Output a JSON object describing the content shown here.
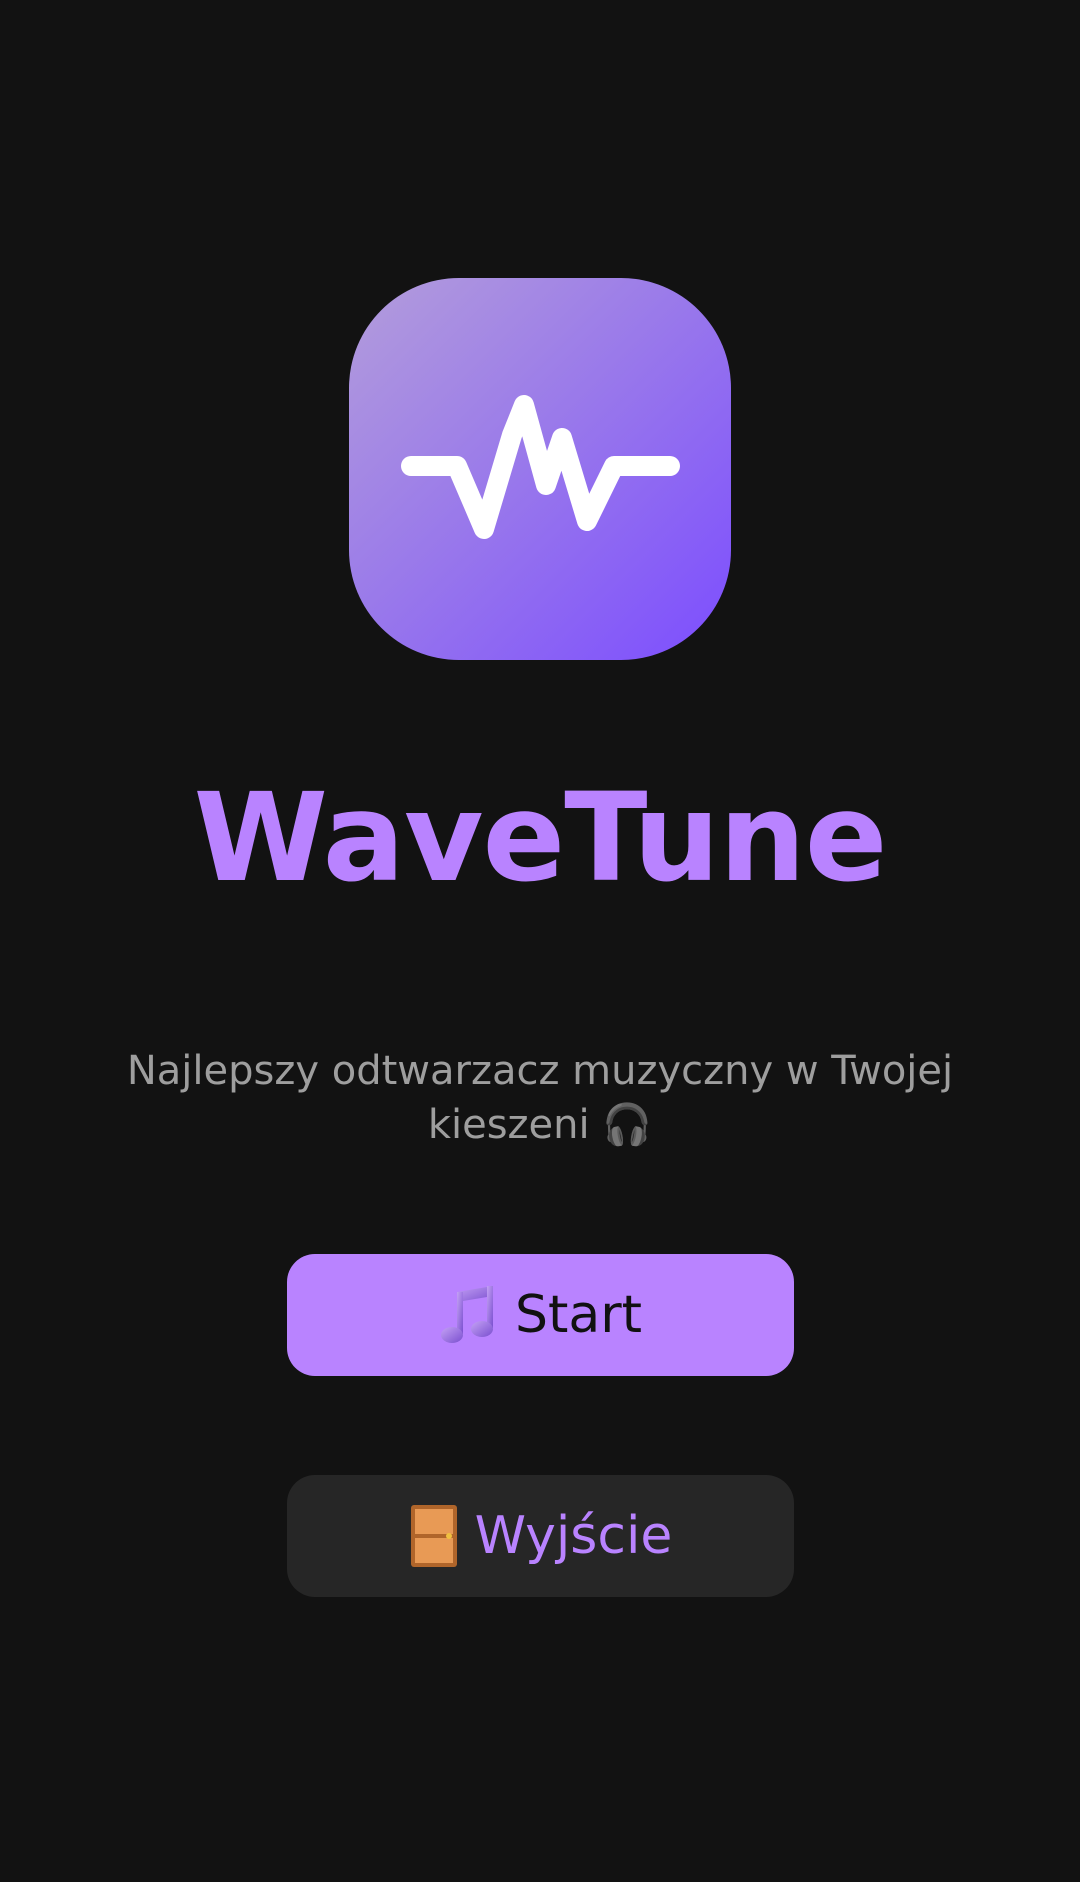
{
  "app": {
    "title": "WaveTune",
    "tagline": "Najlepszy odtwarzacz muzyczny w Twojej kieszeni 🎧"
  },
  "icons": {
    "app_icon": "waveform-icon",
    "start_icon": "music-notes-icon",
    "exit_icon": "door-icon"
  },
  "buttons": {
    "start_label": "Start",
    "exit_label": "Wyjście"
  },
  "colors": {
    "background": "#121212",
    "accent": "#b983ff",
    "secondary_button": "#262626",
    "tagline_text": "#9e9e9e"
  }
}
